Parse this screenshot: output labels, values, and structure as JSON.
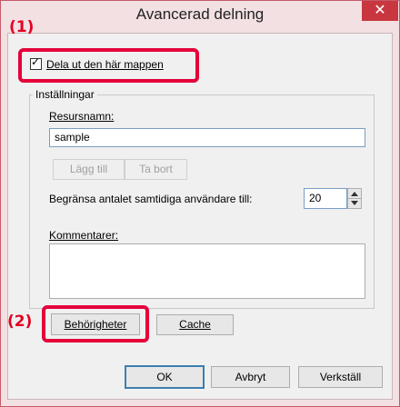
{
  "window": {
    "title": "Avancerad delning",
    "close_glyph": "✕"
  },
  "annotations": {
    "marker1": "(1)",
    "marker2": "(2)"
  },
  "share": {
    "checkbox_label": "Dela ut den här mappen",
    "checked": true
  },
  "settings": {
    "group_label": "Inställningar",
    "resource_label": "Resursnamn:",
    "resource_value": "sample",
    "add_label": "Lägg till",
    "remove_label": "Ta bort",
    "limit_label": "Begränsa antalet samtidiga användare till:",
    "limit_value": "20",
    "comment_label": "Kommentarer:",
    "comment_value": ""
  },
  "buttons": {
    "permissions": "Behörigheter",
    "cache": "Cache",
    "ok": "OK",
    "cancel": "Avbryt",
    "apply": "Verkställ"
  },
  "colors": {
    "accent_red": "#e4003a",
    "close_red": "#c8373f",
    "focus_blue": "#3c7fb1"
  }
}
